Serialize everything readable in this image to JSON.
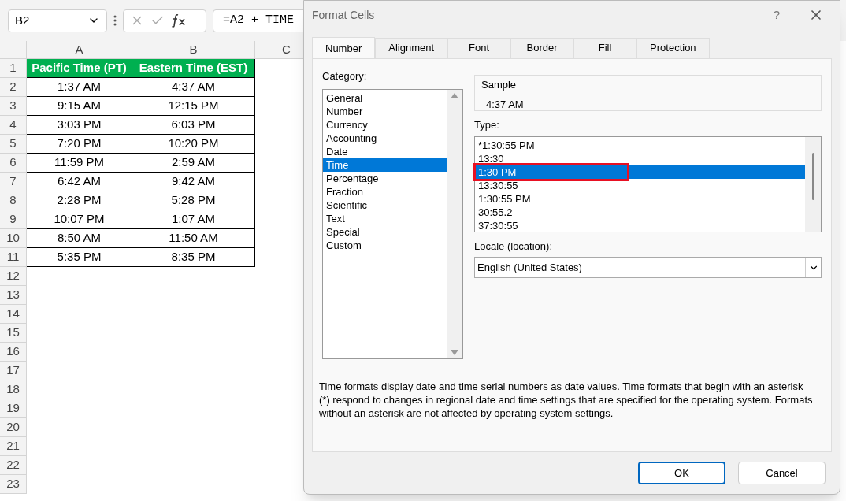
{
  "formula_bar": {
    "name_box": "B2",
    "formula": "=A2 + TIME"
  },
  "sheet": {
    "columns": [
      "A",
      "B",
      "C"
    ],
    "header_row": {
      "number": "1",
      "cells": [
        "Pacific Time (PT)",
        "Eastern Time (EST)"
      ]
    },
    "rows": [
      {
        "number": "2",
        "cells": [
          "1:37 AM",
          "4:37 AM"
        ]
      },
      {
        "number": "3",
        "cells": [
          "9:15 AM",
          "12:15 PM"
        ]
      },
      {
        "number": "4",
        "cells": [
          "3:03 PM",
          "6:03 PM"
        ]
      },
      {
        "number": "5",
        "cells": [
          "7:20 PM",
          "10:20 PM"
        ]
      },
      {
        "number": "6",
        "cells": [
          "11:59 PM",
          "2:59 AM"
        ]
      },
      {
        "number": "7",
        "cells": [
          "6:42 AM",
          "9:42 AM"
        ]
      },
      {
        "number": "8",
        "cells": [
          "2:28 PM",
          "5:28 PM"
        ]
      },
      {
        "number": "9",
        "cells": [
          "10:07 PM",
          "1:07 AM"
        ]
      },
      {
        "number": "10",
        "cells": [
          "8:50 AM",
          "11:50 AM"
        ]
      },
      {
        "number": "11",
        "cells": [
          "5:35 PM",
          "8:35 PM"
        ]
      },
      {
        "number": "12",
        "cells": []
      },
      {
        "number": "13",
        "cells": []
      },
      {
        "number": "14",
        "cells": []
      },
      {
        "number": "15",
        "cells": []
      },
      {
        "number": "16",
        "cells": []
      },
      {
        "number": "17",
        "cells": []
      },
      {
        "number": "18",
        "cells": []
      },
      {
        "number": "19",
        "cells": []
      },
      {
        "number": "20",
        "cells": []
      },
      {
        "number": "21",
        "cells": []
      },
      {
        "number": "22",
        "cells": []
      },
      {
        "number": "23",
        "cells": []
      }
    ]
  },
  "dialog": {
    "title": "Format Cells",
    "help": "?",
    "tabs": [
      {
        "label": "Number",
        "selected": true
      },
      {
        "label": "Alignment",
        "selected": false
      },
      {
        "label": "Font",
        "selected": false
      },
      {
        "label": "Border",
        "selected": false
      },
      {
        "label": "Fill",
        "selected": false
      },
      {
        "label": "Protection",
        "selected": false
      }
    ],
    "category_label": "Category:",
    "categories": [
      {
        "label": "General",
        "selected": false
      },
      {
        "label": "Number",
        "selected": false
      },
      {
        "label": "Currency",
        "selected": false
      },
      {
        "label": "Accounting",
        "selected": false
      },
      {
        "label": "Date",
        "selected": false
      },
      {
        "label": "Time",
        "selected": true
      },
      {
        "label": "Percentage",
        "selected": false
      },
      {
        "label": "Fraction",
        "selected": false
      },
      {
        "label": "Scientific",
        "selected": false
      },
      {
        "label": "Text",
        "selected": false
      },
      {
        "label": "Special",
        "selected": false
      },
      {
        "label": "Custom",
        "selected": false
      }
    ],
    "sample_label": "Sample",
    "sample_value": "4:37 AM",
    "type_label": "Type:",
    "types": [
      {
        "label": "*1:30:55 PM",
        "selected": false,
        "marked": false
      },
      {
        "label": "13:30",
        "selected": false,
        "marked": false
      },
      {
        "label": "1:30 PM",
        "selected": true,
        "marked": true
      },
      {
        "label": "13:30:55",
        "selected": false,
        "marked": false
      },
      {
        "label": "1:30:55 PM",
        "selected": false,
        "marked": false
      },
      {
        "label": "30:55.2",
        "selected": false,
        "marked": false
      },
      {
        "label": "37:30:55",
        "selected": false,
        "marked": false
      }
    ],
    "locale_label": "Locale (location):",
    "locale_value": "English (United States)",
    "description": "Time formats display date and time serial numbers as date values.  Time formats that begin with an asterisk (*) respond to changes in regional date and time settings that are specified for the operating system. Formats without an asterisk are not affected by operating system settings.",
    "buttons": [
      "OK",
      "Cancel"
    ]
  }
}
